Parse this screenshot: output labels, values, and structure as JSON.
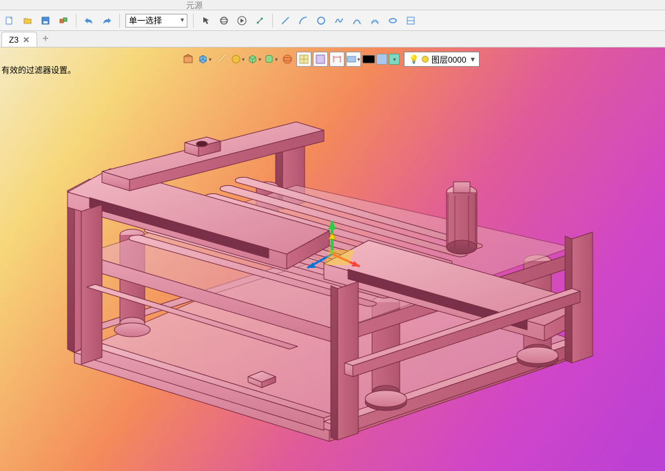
{
  "topbar": {
    "label": "元源"
  },
  "toolbar1": {
    "selection_mode": "单一选择",
    "icons": [
      "file-icon",
      "folder-icon",
      "save-icon",
      "print-icon",
      "undo-icon",
      "redo-icon",
      "pointer-icon",
      "orbit-icon",
      "play-icon",
      "snap-icon",
      "ruler-icon",
      "line-icon",
      "arc-icon",
      "circle-icon",
      "spline-icon",
      "curve-icon",
      "offset-icon",
      "clip-icon"
    ]
  },
  "tab": {
    "name": "Z3",
    "close": "✕",
    "add": "+"
  },
  "viewport": {
    "status": "有效的过滤器设置。",
    "layer_label": "图层0000"
  },
  "float_toolbar": {
    "groups": [
      [
        "view-home-icon",
        "view-iso-icon"
      ],
      [
        "measure-icon"
      ],
      [
        "material-icon"
      ],
      [
        "box-icon",
        "box-drop-icon"
      ],
      [
        "cylinder-icon",
        "cylinder-drop-icon"
      ],
      [
        "sphere-icon"
      ],
      [
        "grid-icon"
      ],
      [
        "section-icon",
        "dim-icon"
      ],
      [
        "display-icon",
        "display-drop-icon"
      ],
      [
        "black-swatch",
        "blue-swatch",
        "teal-swatch",
        "visibility-icon"
      ]
    ]
  }
}
